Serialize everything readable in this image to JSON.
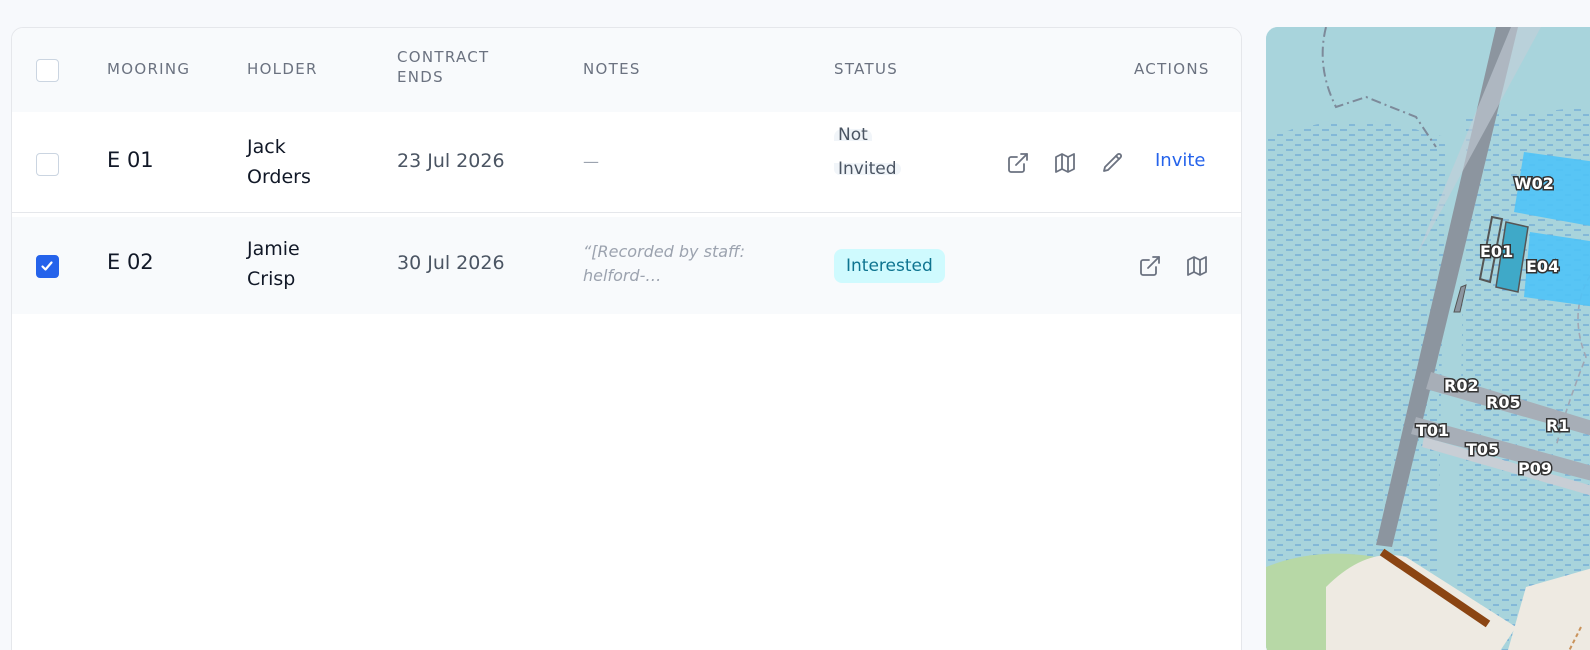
{
  "table": {
    "headers": {
      "mooring": "MOORING",
      "holder": "HOLDER",
      "contract_ends_line1": "CONTRACT",
      "contract_ends_line2": "ENDS",
      "notes": "NOTES",
      "status": "STATUS",
      "actions": "ACTIONS"
    },
    "rows": [
      {
        "selected": false,
        "mooring": "E 01",
        "holder_first": "Jack",
        "holder_last": "Orders",
        "contract_ends": "23 Jul 2026",
        "notes": "—",
        "status_line1": "Not",
        "status_line2": "Invited",
        "action_invite": "Invite"
      },
      {
        "selected": true,
        "mooring": "E 02",
        "holder_first": "Jamie",
        "holder_last": "Crisp",
        "contract_ends": "30 Jul 2026",
        "notes_line1": "“[Recorded by staff:",
        "notes_line2": "helford-…",
        "status": "Interested"
      }
    ]
  },
  "map": {
    "labels": [
      "W02",
      "E01",
      "E04",
      "R02",
      "R05",
      "R1",
      "T01",
      "T05",
      "P09"
    ]
  },
  "colors": {
    "accent": "#2563eb",
    "status_interested_bg": "#cffafe",
    "status_interested_text": "#0e7490",
    "status_not_invited_bg": "#f1f5f9",
    "water": "#a8d4dc",
    "mooring_highlight": "#4fc3f7"
  }
}
